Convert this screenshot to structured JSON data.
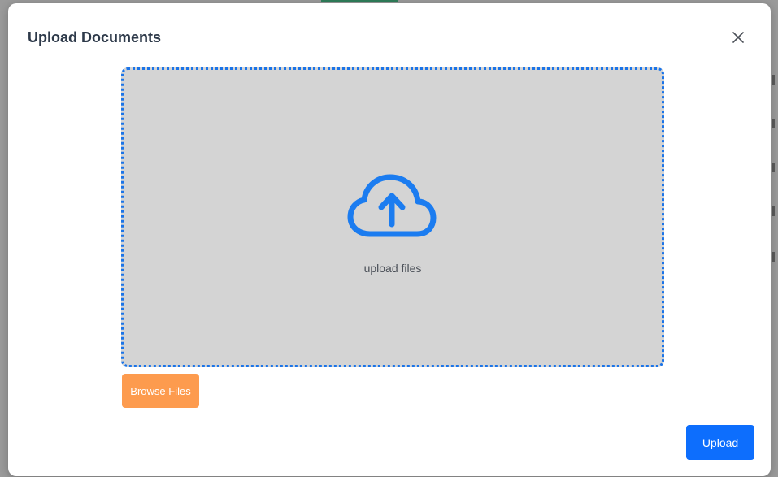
{
  "modal": {
    "title": "Upload Documents",
    "close_icon": "close-icon"
  },
  "dropzone": {
    "icon": "cloud-upload-icon",
    "label": "upload files",
    "border_color": "#1b74e8",
    "background_color": "#d4d4d4"
  },
  "actions": {
    "browse_label": "Browse Files",
    "browse_color": "#fd9b4e",
    "upload_label": "Upload",
    "upload_color": "#0d6efd"
  }
}
